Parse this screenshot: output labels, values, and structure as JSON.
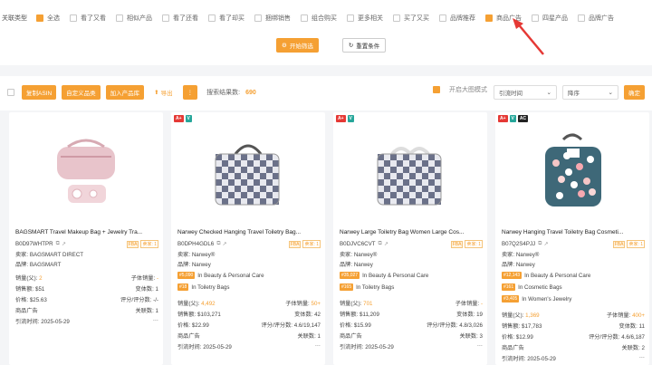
{
  "filters": {
    "label": "关联类型",
    "options": [
      {
        "label": "全选",
        "checked": true
      },
      {
        "label": "看了又看",
        "checked": false
      },
      {
        "label": "相似产品",
        "checked": false
      },
      {
        "label": "看了还看",
        "checked": false
      },
      {
        "label": "看了却买",
        "checked": false
      },
      {
        "label": "捆绑销售",
        "checked": false
      },
      {
        "label": "组合购买",
        "checked": false
      },
      {
        "label": "更多相关",
        "checked": false
      },
      {
        "label": "买了又买",
        "checked": false
      },
      {
        "label": "品牌推荐",
        "checked": false
      },
      {
        "label": "商品广告",
        "checked": true
      },
      {
        "label": "四星产品",
        "checked": false
      },
      {
        "label": "品牌广告",
        "checked": false
      }
    ],
    "start_button": "开始筛选",
    "reset_button": "重置条件"
  },
  "toolbar": {
    "copy_asin": "复制ASIN",
    "custom_picker": "自定义品类",
    "add_to_lib": "加入产品库",
    "export": "导出",
    "more": "⋮",
    "result_label": "搜索结果数:",
    "result_count": "690",
    "bigimg_label": "开启大图模式",
    "sort_field": "引流时间",
    "sort_order": "降序",
    "confirm": "确定"
  },
  "products": [
    {
      "badges": [],
      "title": "BAGSMART Travel Makeup Bag + Jewelry Tra...",
      "asin": "B0D97WHTPR",
      "seller": "卖家: BAGSMART DIRECT",
      "brand": "品牌: BAGSMART",
      "fba": "FBA",
      "seller_tag": "卖家: 1",
      "ranks": [],
      "f1l": "销量(父):",
      "f1v": "2",
      "f1r": "子体销量:",
      "f1rv": "-",
      "f2l": "销售额:",
      "f2v": "$51",
      "f2r": "变体数:",
      "f2rv": "1",
      "f3l": "价格:",
      "f3v": "$25.63",
      "f3r": "评分/评分数:",
      "f3rv": "-/-",
      "f4l": "商品广告",
      "f4r": "关联数:",
      "f4rv": "1",
      "date_label": "引流时间:",
      "date": "2025-05-29"
    },
    {
      "badges": [
        "A+",
        "V"
      ],
      "title": "Narwey Checked Hanging Travel Toiletry Bag...",
      "asin": "B0DPH4GDL6",
      "seller": "卖家: Narwey®",
      "brand": "品牌: Narwey",
      "fba": "FBA",
      "seller_tag": "卖家: 1",
      "ranks": [
        {
          "no": "#5,090",
          "cat": "In Beauty & Personal Care"
        },
        {
          "no": "#18",
          "cat": "In Toiletry Bags"
        }
      ],
      "f1l": "销量(父):",
      "f1v": "4,492",
      "f1r": "子体销量:",
      "f1rv": "50+",
      "f2l": "销售额:",
      "f2v": "$103,271",
      "f2r": "变体数:",
      "f2rv": "42",
      "f3l": "价格:",
      "f3v": "$22.99",
      "f3r": "评分/评分数:",
      "f3rv": "4.6/19,147",
      "f4l": "商品广告",
      "f4r": "关联数:",
      "f4rv": "1",
      "date_label": "引流时间:",
      "date": "2025-05-29"
    },
    {
      "badges": [
        "A+",
        "V"
      ],
      "title": "Narwey Large Toiletry Bag Women Large Cos...",
      "asin": "B0DJVC6CVT",
      "seller": "卖家: Narwey®",
      "brand": "品牌: Narwey",
      "fba": "FBA",
      "seller_tag": "卖家: 1",
      "ranks": [
        {
          "no": "#35,027",
          "cat": "In Beauty & Personal Care"
        },
        {
          "no": "#165",
          "cat": "In Toiletry Bags"
        }
      ],
      "f1l": "销量(父):",
      "f1v": "701",
      "f1r": "子体销量:",
      "f1rv": "-",
      "f2l": "销售额:",
      "f2v": "$11,209",
      "f2r": "变体数:",
      "f2rv": "19",
      "f3l": "价格:",
      "f3v": "$15.99",
      "f3r": "评分/评分数:",
      "f3rv": "4.8/3,026",
      "f4l": "商品广告",
      "f4r": "关联数:",
      "f4rv": "3",
      "date_label": "引流时间:",
      "date": "2025-05-29"
    },
    {
      "badges": [
        "A+",
        "V",
        "AC"
      ],
      "title": "Narwey Hanging Travel Toiletry Bag Cosmeti...",
      "asin": "B07Q2S4PJJ",
      "seller": "卖家: Narwey®",
      "brand": "品牌: Narwey",
      "fba": "FBA",
      "seller_tag": "卖家: 1",
      "ranks": [
        {
          "no": "#12,143",
          "cat": "In Beauty & Personal Care"
        },
        {
          "no": "#161",
          "cat": "In Cosmetic Bags"
        },
        {
          "no": "#3,405",
          "cat": "In Women's Jewelry"
        }
      ],
      "f1l": "销量(父):",
      "f1v": "1,369",
      "f1r": "子体销量:",
      "f1rv": "400+",
      "f2l": "销售额:",
      "f2v": "$17,783",
      "f2r": "变体数:",
      "f2rv": "11",
      "f3l": "价格:",
      "f3v": "$12.99",
      "f3r": "评分/评分数:",
      "f3rv": "4.6/6,187",
      "f4l": "商品广告",
      "f4r": "关联数:",
      "f4rv": "2",
      "date_label": "引流时间:",
      "date": "2025-05-29"
    }
  ]
}
